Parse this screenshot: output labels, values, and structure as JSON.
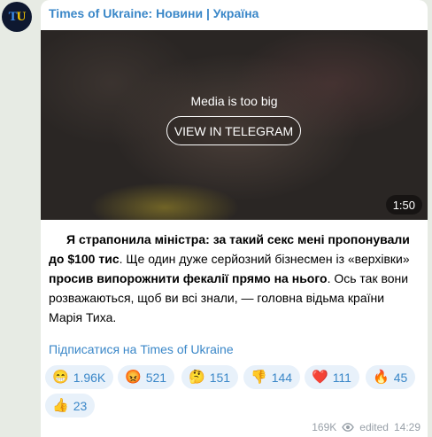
{
  "channel": {
    "name": "Times of Ukraine: Новини | Україна",
    "avatar_letters": [
      "T",
      "U"
    ]
  },
  "media": {
    "message": "Media is too big",
    "button_label": "VIEW IN TELEGRAM",
    "duration": "1:50"
  },
  "post": {
    "bold1": "Я страпонила міністра: за такий секс мені пропонували до $100 тис",
    "text1": ". Ще один дуже серйозний бізнесмен із «верхівки» ",
    "bold2": "просив випорожнити фекалії прямо на нього",
    "text2": ". Ось так вони розважаються, щоб ви всі знали, — головна відьма країни Марія Тиха."
  },
  "subscribe_link": "Підписатися на Times of Ukraine",
  "reactions": [
    {
      "emoji": "😁",
      "count": "1.96K"
    },
    {
      "emoji": "😡",
      "count": "521"
    },
    {
      "emoji": "🤔",
      "count": "151"
    },
    {
      "emoji": "👎",
      "count": "144"
    },
    {
      "emoji": "❤️",
      "count": "111"
    },
    {
      "emoji": "🔥",
      "count": "45"
    },
    {
      "emoji": "👍",
      "count": "23"
    }
  ],
  "meta": {
    "views": "169K",
    "edited_label": "edited",
    "time": "14:29"
  },
  "colors": {
    "link": "#3a87c8",
    "reaction_bg": "#e8f1fa",
    "background": "#e7ebe4"
  }
}
